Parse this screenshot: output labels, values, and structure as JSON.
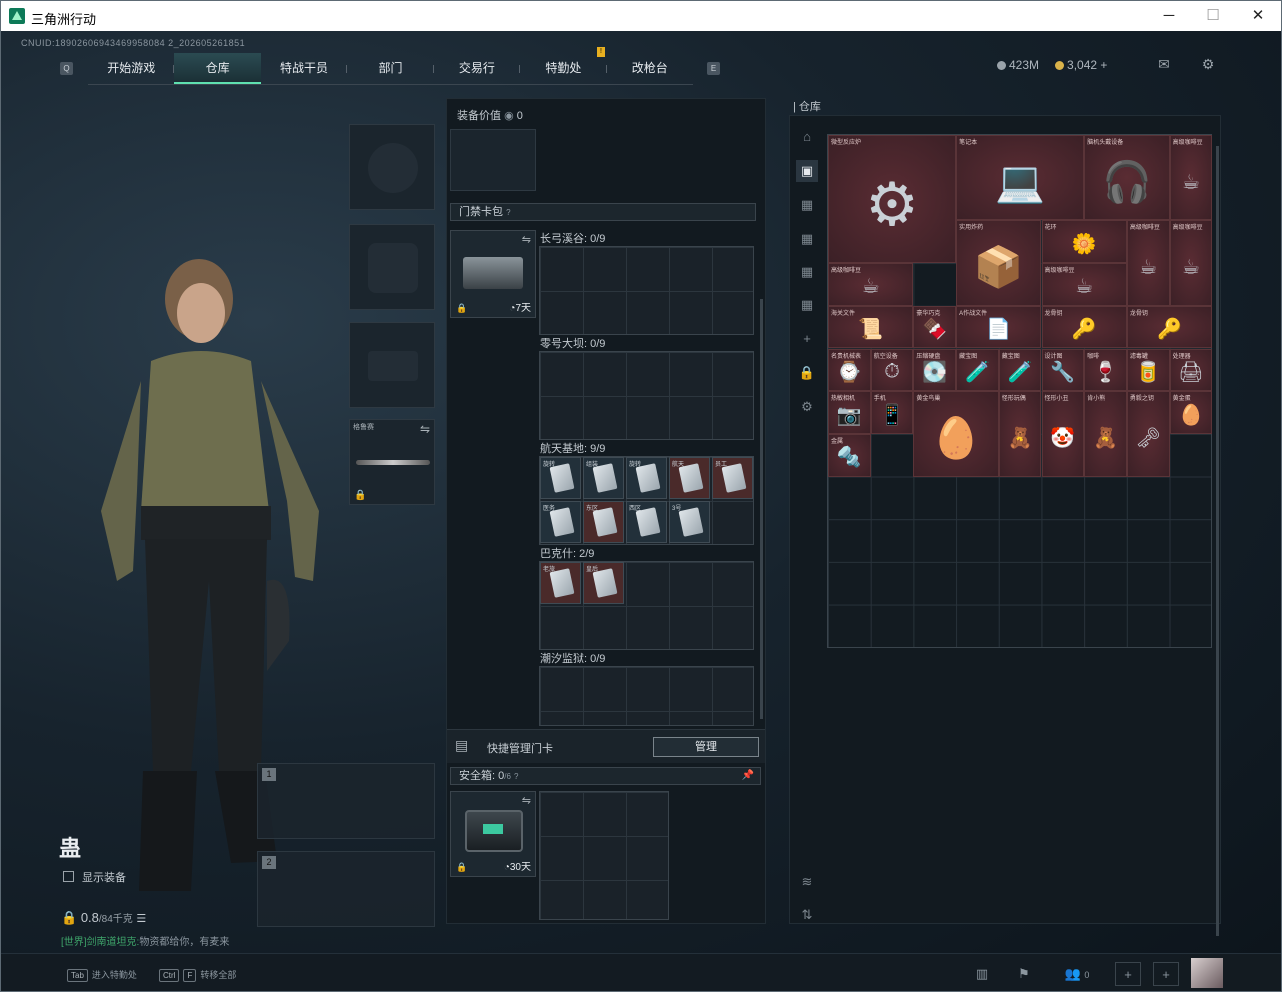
{
  "window": {
    "title": "三角洲行动",
    "minimize": "─",
    "maximize": "☐",
    "close": "✕"
  },
  "header": {
    "uid": "CNUID:18902606943469958084 2_202605261851",
    "tabs": [
      "开始游戏",
      "仓库",
      "特战干员",
      "部门",
      "交易行",
      "特勤处",
      "改枪台"
    ],
    "active_tab": "仓库",
    "notification_badge": "!",
    "currency": {
      "credits": "423M",
      "coins": "3,042",
      "coins_add": "+"
    }
  },
  "player": {
    "name": "蛊",
    "show_equipment": "显示装备",
    "weight": "0.8",
    "weight_capacity": "/84千克",
    "chat_channel": "[世界]剑南道坦克:",
    "chat_text": "物资都给你，有麦来"
  },
  "slots": {
    "melee_label": "格鲁赛",
    "weapon1_num": "1",
    "weapon2_num": "2"
  },
  "middle": {
    "equip_value_label": "装备价值",
    "equip_value": "0",
    "keycard_bag_label": "门禁卡包",
    "keycard_days": "7天",
    "maps": [
      {
        "name": "长弓溪谷: 0/9"
      },
      {
        "name": "零号大坝: 0/9"
      },
      {
        "name": "航天基地: 9/9"
      },
      {
        "name": "巴克什: 2/9"
      },
      {
        "name": "潮汐监狱: 0/9"
      }
    ],
    "hangtian_cards": [
      "旋转",
      "组装",
      "旋转",
      "航天",
      "员工",
      "医务",
      "东区",
      "西区",
      "3号"
    ],
    "bakeshi_cards": [
      "老旅",
      "皇后"
    ],
    "quick_manage_label": "快捷管理门卡",
    "manage_button": "管理",
    "safe_box_label": "安全箱:",
    "safe_box_count": "0",
    "safe_box_total": "/6",
    "safe_box_days": "30天"
  },
  "right": {
    "stash_label": "仓库",
    "items": [
      {
        "name": "微型反应炉",
        "glyph": "⚙"
      },
      {
        "name": "笔记本",
        "glyph": "💻"
      },
      {
        "name": "脑机头戴设备",
        "glyph": "🎧"
      },
      {
        "name": "高级咖啡豆",
        "glyph": "☕"
      },
      {
        "name": "实用炸药",
        "glyph": "📦"
      },
      {
        "name": "花环",
        "glyph": "🌼"
      },
      {
        "name": "高级咖啡豆",
        "glyph": "☕"
      },
      {
        "name": "高级咖啡豆",
        "glyph": "☕"
      },
      {
        "name": "高级咖啡豆",
        "glyph": "☕"
      },
      {
        "name": "高级咖啡豆",
        "glyph": "☕"
      },
      {
        "name": "海关文件",
        "glyph": "📜"
      },
      {
        "name": "豪华巧克",
        "glyph": "🍫"
      },
      {
        "name": "A作战文件",
        "glyph": "📄"
      },
      {
        "name": "龙骨钥",
        "glyph": "🔑"
      },
      {
        "name": "龙骨钥",
        "glyph": "🔑"
      },
      {
        "name": "名贵机械表",
        "glyph": "⌚"
      },
      {
        "name": "航空设备",
        "glyph": "⏱"
      },
      {
        "name": "压缩硬盘",
        "glyph": "💽"
      },
      {
        "name": "藏宝图",
        "glyph": "🧪"
      },
      {
        "name": "藏宝图",
        "glyph": "🧪"
      },
      {
        "name": "设计图",
        "glyph": "🔧"
      },
      {
        "name": "咖啡",
        "glyph": "🍷"
      },
      {
        "name": "滤毒罐",
        "glyph": "🥫"
      },
      {
        "name": "处理器",
        "glyph": "🖨"
      },
      {
        "name": "热敏相机",
        "glyph": "📷"
      },
      {
        "name": "手机",
        "glyph": "📱"
      },
      {
        "name": "黄金鸟巢",
        "glyph": "🥚"
      },
      {
        "name": "怪形玩偶",
        "glyph": "🧸"
      },
      {
        "name": "怪形小丑",
        "glyph": "🤡"
      },
      {
        "name": "肯小熊",
        "glyph": "🧸"
      },
      {
        "name": "勇毅之钥",
        "glyph": "🗝"
      },
      {
        "name": "黄金蛋",
        "glyph": "🥚"
      },
      {
        "name": "金属",
        "glyph": "🔩"
      }
    ]
  },
  "bottom": {
    "hint1_key": "Tab",
    "hint1": "进入特勤处",
    "hint2_key1": "Ctrl",
    "hint2_key2": "F",
    "hint2": "转移全部",
    "friends_count": "0"
  }
}
